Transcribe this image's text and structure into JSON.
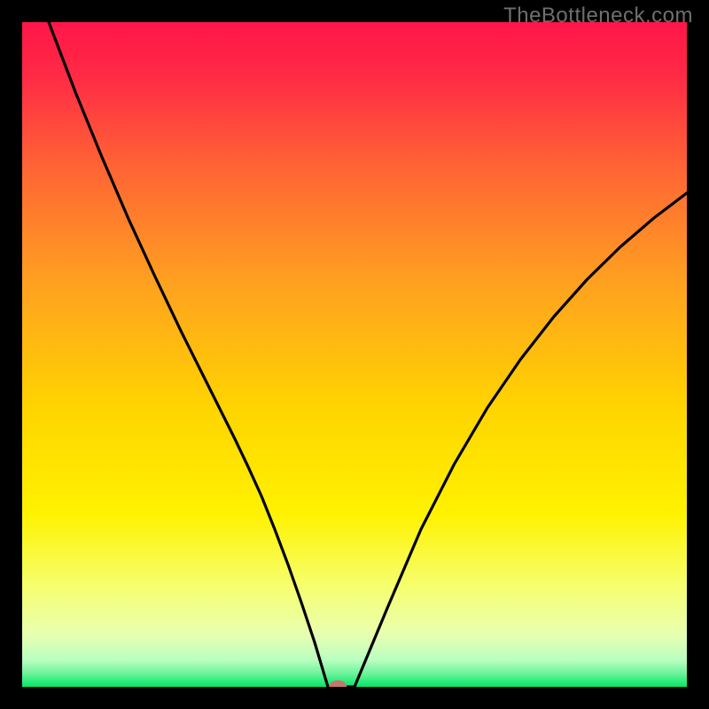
{
  "watermark": "TheBottleneck.com",
  "chart_data": {
    "type": "line",
    "title": "",
    "xlabel": "",
    "ylabel": "",
    "xlim": [
      0,
      100
    ],
    "ylim": [
      0,
      100
    ],
    "x": [
      4.0,
      8.0,
      12.0,
      16.0,
      20.0,
      24.0,
      28.0,
      32.0,
      34.0,
      36.0,
      38.0,
      40.0,
      42.0,
      44.0,
      46.0,
      50.0,
      55.0,
      60.0,
      65.0,
      70.0,
      75.0,
      80.0,
      85.0,
      90.0,
      95.0,
      100.0
    ],
    "values": [
      100.0,
      89.5,
      79.7,
      70.4,
      61.7,
      53.3,
      45.3,
      37.3,
      33.1,
      28.7,
      23.7,
      18.4,
      12.7,
      6.7,
      0.0,
      0.0,
      12.0,
      23.7,
      33.5,
      42.0,
      49.3,
      55.7,
      61.3,
      66.2,
      70.5,
      74.3
    ],
    "marker_point": {
      "x": 47.5,
      "y": 0
    },
    "gradient_colors": {
      "top": "#ff1648",
      "mid_upper": "#ff8b2a",
      "mid": "#ffe400",
      "mid_lower": "#faff7d",
      "bottom": "#00e865"
    }
  }
}
